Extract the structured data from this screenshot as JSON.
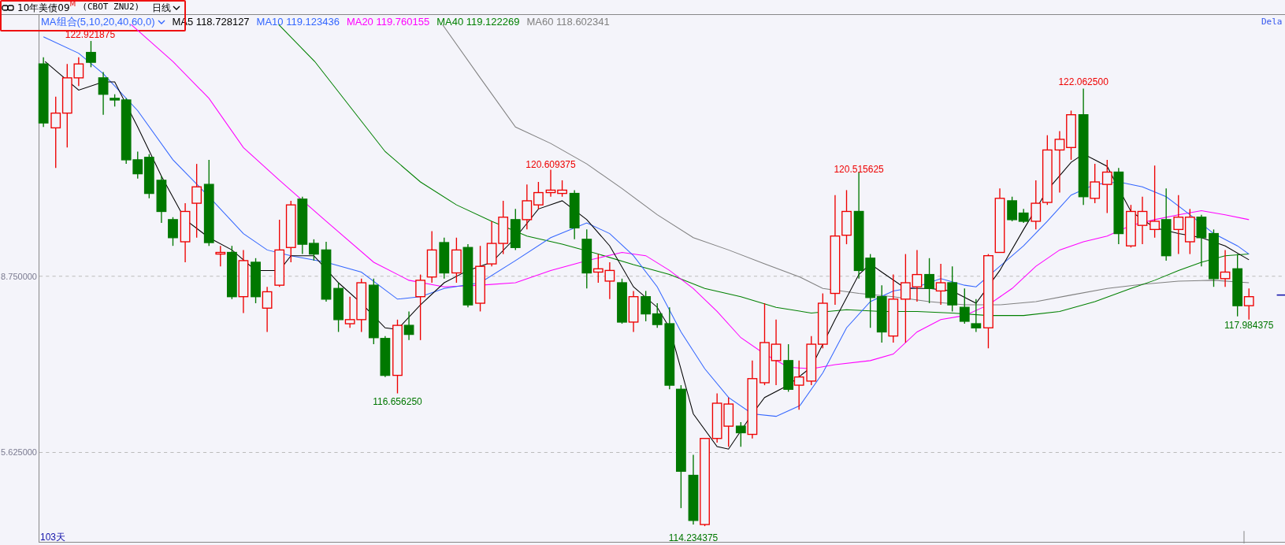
{
  "header": {
    "instrument": "10年美债09",
    "flag": "M",
    "code": "(CBOT ZNU2)",
    "period": "日线"
  },
  "legend": {
    "preset": "MA组合(5,10,20,40,60,0)",
    "items": [
      {
        "label": "MA5",
        "value": "118.728127",
        "color": "#000000"
      },
      {
        "label": "MA10",
        "value": "119.123436",
        "color": "#3366ff"
      },
      {
        "label": "MA20",
        "value": "119.760155",
        "color": "#ff00ff"
      },
      {
        "label": "MA40",
        "value": "119.122269",
        "color": "#008000"
      },
      {
        "label": "MA60",
        "value": "118.602341",
        "color": "#808080"
      }
    ]
  },
  "status": "Dela",
  "chart": {
    "y_labels": [
      "8.750000",
      "5.625000"
    ],
    "price_marks": [
      {
        "text": "122.921875",
        "kind": "high"
      },
      {
        "text": "120.609375",
        "kind": "high"
      },
      {
        "text": "120.515625",
        "kind": "high"
      },
      {
        "text": "122.062500",
        "kind": "high"
      },
      {
        "text": "116.656250",
        "kind": "low"
      },
      {
        "text": "114.234375",
        "kind": "low"
      },
      {
        "text": "117.984375",
        "kind": "low"
      }
    ],
    "days": "103天"
  }
}
